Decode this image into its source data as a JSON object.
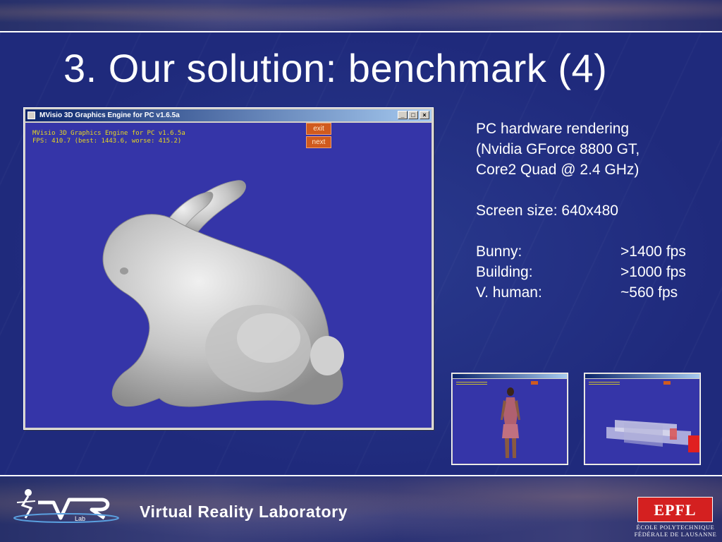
{
  "slide": {
    "title": "3. Our solution: benchmark (4)"
  },
  "window": {
    "title": "MVisio 3D Graphics Engine for PC v1.6.5a",
    "minimize_glyph": "_",
    "maximize_glyph": "□",
    "close_glyph": "×",
    "hud_line1": "MVisio 3D Graphics Engine for PC v1.6.5a",
    "hud_line2": "FPS: 410.7 (best: 1443.6, worse: 415.2)",
    "exit_label": "exit",
    "next_label": "next"
  },
  "info": {
    "line1": "PC hardware rendering",
    "line2": "(Nvidia GForce 8800 GT,",
    "line3": "Core2 Quad @ 2.4 GHz)",
    "screen_size": "Screen size: 640x480",
    "results": [
      {
        "label": "Bunny:",
        "value": ">1400 fps"
      },
      {
        "label": "Building:",
        "value": ">1000 fps"
      },
      {
        "label": "V. human:",
        "value": "~560 fps"
      }
    ]
  },
  "footer": {
    "lab_name": "Virtual Reality Laboratory",
    "logo_text": "Lab",
    "epfl_mark": "EPFL",
    "epfl_line1": "ÉCOLE POLYTECHNIQUE",
    "epfl_line2": "FÉDÉRALE DE LAUSANNE"
  },
  "colors": {
    "background": "#1e2a78",
    "viewport": "#3535a8",
    "hud_text": "#e8d820",
    "button": "#d05a1e",
    "epfl_red": "#d42020"
  }
}
